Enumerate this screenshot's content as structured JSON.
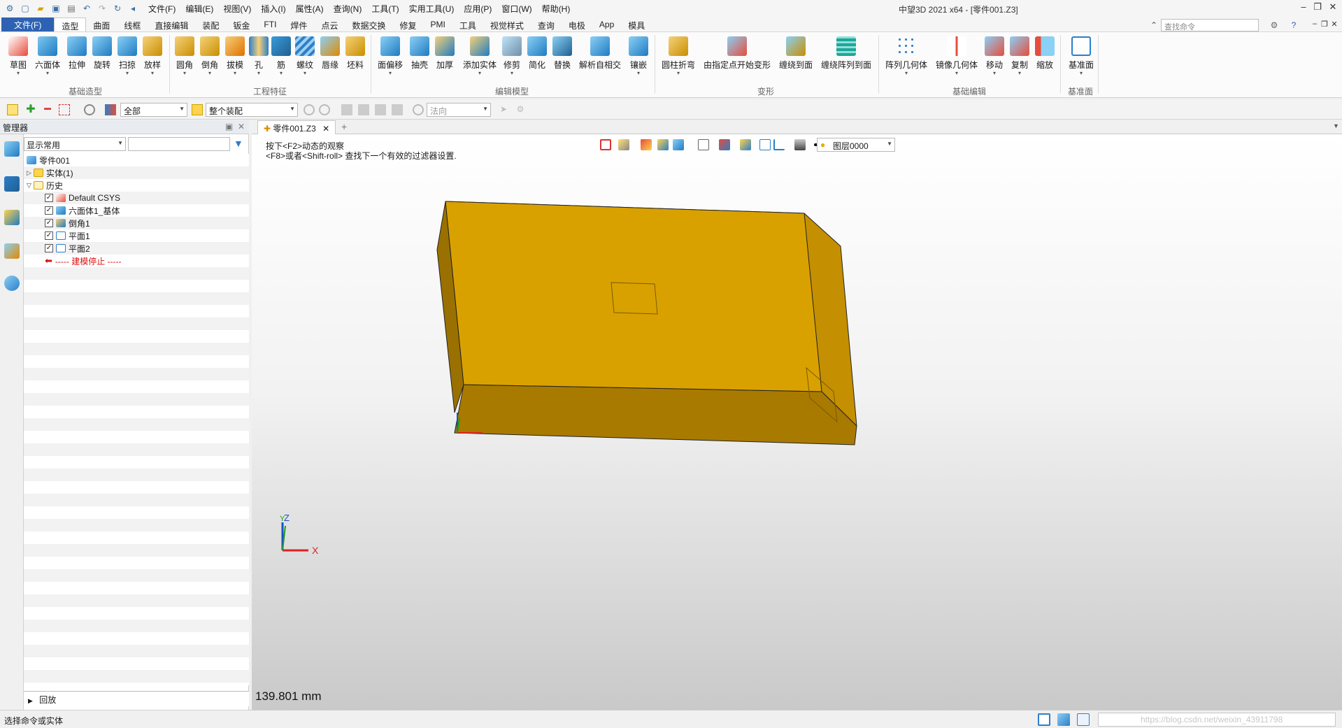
{
  "window": {
    "title": "中望3D 2021 x64 - [零件001.Z3]",
    "menu": [
      "文件(F)",
      "编辑(E)",
      "视图(V)",
      "插入(I)",
      "属性(A)",
      "查询(N)",
      "工具(T)",
      "实用工具(U)",
      "应用(P)",
      "窗口(W)",
      "帮助(H)"
    ]
  },
  "ribbon_tabs": {
    "file": "文件(F)",
    "tabs": [
      "造型",
      "曲面",
      "线框",
      "直接编辑",
      "装配",
      "钣金",
      "FTI",
      "焊件",
      "点云",
      "数据交换",
      "修复",
      "PMI",
      "工具",
      "视觉样式",
      "查询",
      "电极",
      "App",
      "模具"
    ],
    "active": "造型",
    "search_placeholder": "查找命令"
  },
  "ribbon": {
    "groups": [
      {
        "label": "基础造型",
        "buttons": [
          "草图",
          "六面体",
          "拉伸",
          "旋转",
          "扫掠",
          "放样"
        ]
      },
      {
        "label": "工程特征",
        "buttons": [
          "圆角",
          "倒角",
          "拔模",
          "孔",
          "筋",
          "螺纹",
          "唇缘",
          "坯料"
        ]
      },
      {
        "label": "编辑模型",
        "buttons": [
          "面偏移",
          "抽壳",
          "加厚",
          "添加实体",
          "修剪",
          "简化",
          "替换",
          "解析自相交",
          "镶嵌"
        ]
      },
      {
        "label": "变形",
        "buttons": [
          "圆柱折弯",
          "由指定点开始变形",
          "缠绕到面",
          "缠绕阵列到面"
        ]
      },
      {
        "label": "基础编辑",
        "buttons": [
          "阵列几何体",
          "镜像几何体",
          "移动",
          "复制",
          "缩放"
        ]
      },
      {
        "label": "基准面",
        "buttons": [
          "基准面"
        ]
      }
    ]
  },
  "toolbar": {
    "filter_value": "全部",
    "assembly_value": "整个装配",
    "direction_placeholder": "法向"
  },
  "manager": {
    "title": "管理器",
    "display_filter": "显示常用",
    "tree": {
      "root": "零件001",
      "solids": "实体(1)",
      "history": "历史",
      "items": [
        "Default CSYS",
        "六面体1_基体",
        "倒角1",
        "平面1",
        "平面2"
      ],
      "stop": "----- 建模停止 -----"
    },
    "rollback": "回放"
  },
  "document": {
    "tab": "零件001.Z3",
    "hint_line1": "按下<F2>动态的观察",
    "hint_line2": "<F8>或者<Shift-roll> 查找下一个有效的过滤器设置.",
    "layer": "图层0000",
    "zoom_readout": "139.801 mm",
    "axis_labels": {
      "x": "X",
      "y": "Y",
      "z": "Z"
    }
  },
  "statusbar": {
    "text": "选择命令或实体",
    "watermark": "https://blog.csdn.net/weixin_43911798"
  },
  "colors": {
    "part_face_top": "#d9a100",
    "part_face_front": "#b07f00",
    "part_face_side": "#c48f00",
    "accent_blue": "#2d62b3"
  }
}
